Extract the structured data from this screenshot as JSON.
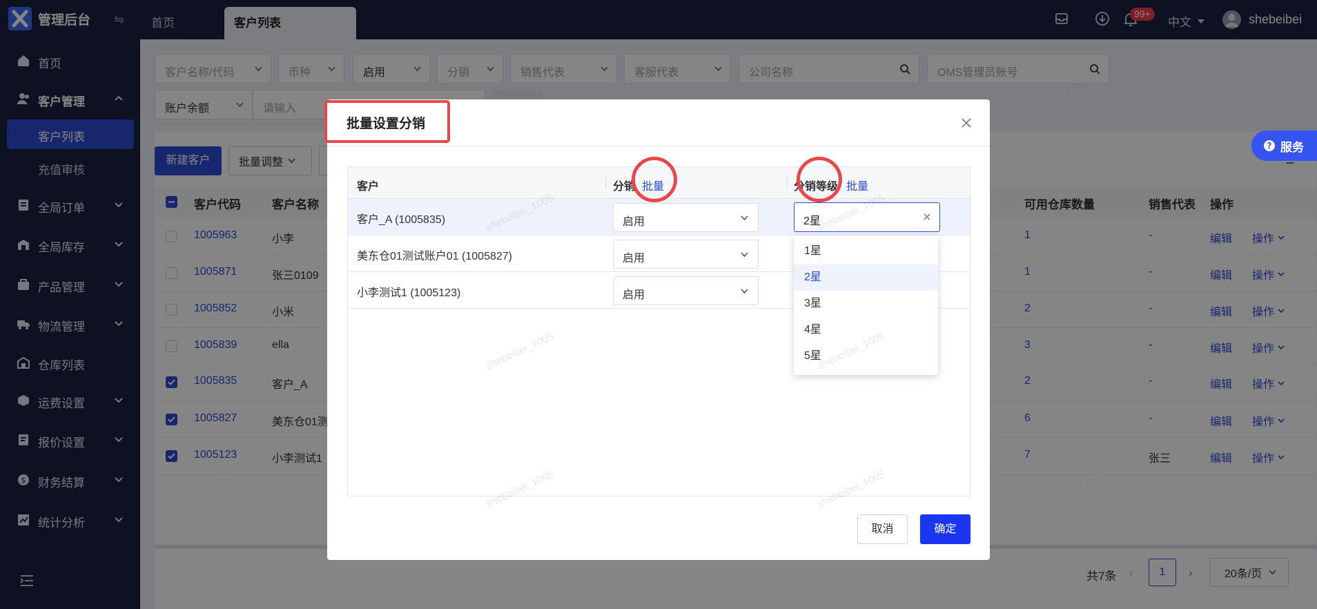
{
  "app": {
    "title": "管理后台"
  },
  "tabs": [
    {
      "label": "首页"
    },
    {
      "label": "客户列表"
    }
  ],
  "header": {
    "notification_count": "99+",
    "language": "中文",
    "username": "shebeibei"
  },
  "sidebar": {
    "items": [
      {
        "label": "首页",
        "icon": "home-icon"
      },
      {
        "label": "客户管理",
        "icon": "users-icon"
      },
      {
        "label": "客户列表"
      },
      {
        "label": "充值审核"
      },
      {
        "label": "全局订单",
        "icon": "orders-icon"
      },
      {
        "label": "全局库存",
        "icon": "inventory-icon"
      },
      {
        "label": "产品管理",
        "icon": "product-icon"
      },
      {
        "label": "物流管理",
        "icon": "truck-icon"
      },
      {
        "label": "仓库列表",
        "icon": "warehouse-icon"
      },
      {
        "label": "运费设置",
        "icon": "shipping-fee-icon"
      },
      {
        "label": "报价设置",
        "icon": "quote-icon"
      },
      {
        "label": "财务结算",
        "icon": "finance-icon"
      },
      {
        "label": "统计分析",
        "icon": "chart-icon"
      }
    ]
  },
  "filters": {
    "customer": "客户名称/代码",
    "currency": "币种",
    "status": "启用",
    "distribution": "分销",
    "sales_rep": "销售代表",
    "service_rep": "客服代表",
    "company_placeholder": "公司名称",
    "oms_placeholder": "OMS管理员账号",
    "balance": "账户余额",
    "balance_placeholder": "请输入"
  },
  "toolbar": {
    "new_customer": "新建客户",
    "batch_adjust": "批量调整"
  },
  "service_button": "服务",
  "table": {
    "headers": {
      "code": "客户代码",
      "name": "客户名称",
      "warehouses": "可用仓库数量",
      "sales": "销售代表",
      "ops": "操作"
    },
    "rows": [
      {
        "code": "1005963",
        "name": "小李",
        "warehouses": "1",
        "sales": "-",
        "checked": false
      },
      {
        "code": "1005871",
        "name": "张三0109",
        "warehouses": "1",
        "sales": "-",
        "checked": false
      },
      {
        "code": "1005852",
        "name": "小米",
        "warehouses": "2",
        "sales": "-",
        "checked": false
      },
      {
        "code": "1005839",
        "name": "ella",
        "warehouses": "3",
        "sales": "-",
        "checked": false
      },
      {
        "code": "1005835",
        "name": "客户_A",
        "warehouses": "2",
        "sales": "-",
        "checked": true
      },
      {
        "code": "1005827",
        "name": "美东仓01测",
        "warehouses": "6",
        "sales": "-",
        "checked": true
      },
      {
        "code": "1005123",
        "name": "小李测试1",
        "warehouses": "7",
        "sales": "张三",
        "checked": true
      }
    ],
    "edit_label": "编辑",
    "ops_label": "操作"
  },
  "pagination": {
    "total": "共7条",
    "page": "1",
    "page_size": "20条/页"
  },
  "modal": {
    "title": "批量设置分销",
    "columns": {
      "customer": "客户",
      "distribution": "分销",
      "level": "分销等级",
      "batch": "批量"
    },
    "rows": [
      {
        "customer": "客户_A (1005835)",
        "distribution": "启用",
        "level": "2星"
      },
      {
        "customer": "美东仓01测试账户01 (1005827)",
        "distribution": "启用"
      },
      {
        "customer": "小李测试1 (1005123)",
        "distribution": "启用"
      }
    ],
    "level_options": [
      "1星",
      "2星",
      "3星",
      "4星",
      "5星"
    ],
    "selected_level": "2星",
    "cancel": "取消",
    "confirm": "确定"
  },
  "watermark": "shebeibei_1005",
  "colors": {
    "primary": "#2f4bd1",
    "nav_bg": "#1b2240",
    "highlight": "#e8474b",
    "confirm": "#1a36f0"
  }
}
